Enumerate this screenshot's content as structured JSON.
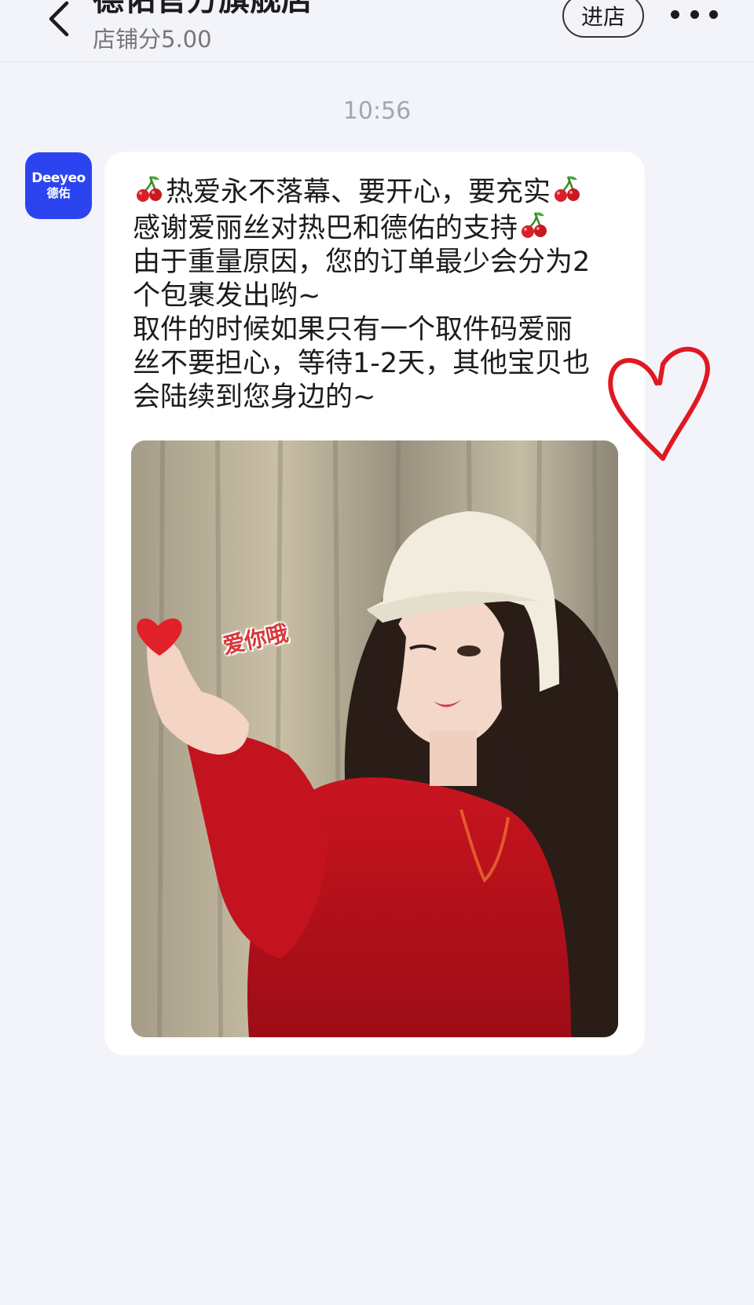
{
  "header": {
    "title": "德佑官方旗舰店",
    "store_score": "店铺分5.00",
    "enter_store_label": "进店",
    "back_icon": "chevron-left-icon",
    "more_icon": "more-horizontal-icon"
  },
  "timestamp": "10:56",
  "avatar": {
    "brand_en": "Deeyeo",
    "brand_cn": "德佑",
    "background_color": "#2c44f0"
  },
  "message": {
    "lines": [
      "热爱永不落幕、要开心，要充实",
      "感谢爱丽丝对热巴和德佑的支持",
      "由于重量原因，您的订单最少会分为2",
      "个包裹发出哟~",
      "取件的时候如果只有一个取件码爱丽",
      "丝不要担心，等待1-2天，其他宝贝也",
      "会陆续到您身边的~"
    ],
    "emoji_icon": "cherry-icon"
  },
  "photo": {
    "sticker_text": "爱你哦",
    "subject": "woman in white hat and red sweater making finger heart"
  },
  "overlay": {
    "heart_color": "#e01822",
    "heart_icon": "hand-drawn-heart-icon"
  }
}
